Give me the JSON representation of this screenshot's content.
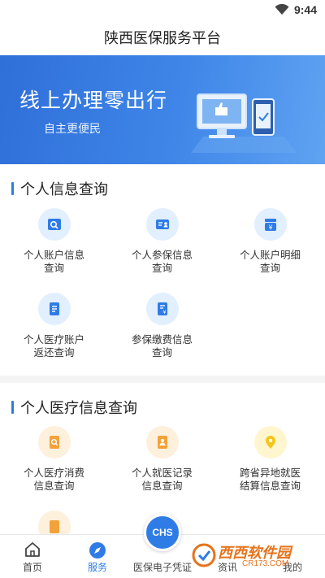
{
  "status": {
    "time": "9:44"
  },
  "header": {
    "title": "陕西医保服务平台"
  },
  "banner": {
    "title": "线上办理零出行",
    "subtitle": "自主更便民"
  },
  "personal_info": {
    "title": "个人信息查询",
    "items": [
      {
        "line1": "个人账户信息",
        "line2": "查询",
        "icon": "search-card-icon"
      },
      {
        "line1": "个人参保信息",
        "line2": "查询",
        "icon": "id-card-icon"
      },
      {
        "line1": "个人账户明细",
        "line2": "查询",
        "icon": "yuan-wallet-icon"
      },
      {
        "line1": "个人医疗账户",
        "line2": "返还查询",
        "icon": "document-list-icon"
      },
      {
        "line1": "参保缴费信息",
        "line2": "查询",
        "icon": "payment-document-icon"
      }
    ]
  },
  "medical_info": {
    "title": "个人医疗信息查询",
    "items": [
      {
        "line1": "个人医疗消费",
        "line2": "信息查询",
        "icon": "consumption-search-icon"
      },
      {
        "line1": "个人就医记录",
        "line2": "信息查询",
        "icon": "medical-record-icon"
      },
      {
        "line1": "跨省异地就医",
        "line2": "结算信息查询",
        "icon": "location-pin-icon"
      }
    ]
  },
  "tabbar": {
    "home": "首页",
    "service": "服务",
    "ecard": "医保电子凭证",
    "news": "资讯",
    "mine": "我的",
    "fab_text": "CHS"
  },
  "watermark": {
    "text": "西西软件园",
    "sub": "CR173.COM"
  },
  "colors": {
    "accent": "#2f7ce6",
    "orange": "#f3a23b",
    "yellow": "#f5c518"
  }
}
